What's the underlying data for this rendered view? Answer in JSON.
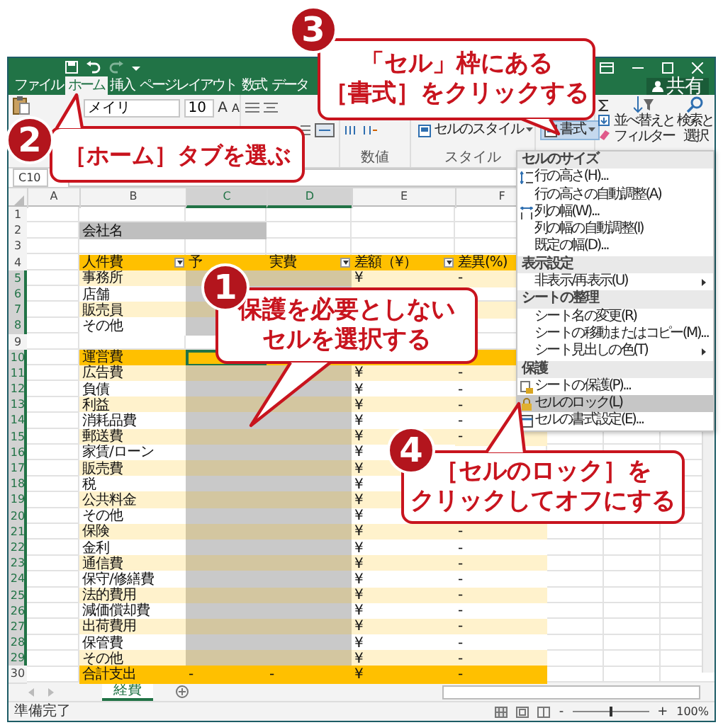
{
  "tabs": [
    {
      "label": "ファイル",
      "selected": false
    },
    {
      "label": "ホーム",
      "selected": true
    },
    {
      "label": "挿入",
      "selected": false
    },
    {
      "label": "ページレイアウト",
      "selected": false
    },
    {
      "label": "数式",
      "selected": false
    },
    {
      "label": "データ",
      "selected": false
    }
  ],
  "share_button": "共有",
  "ribbon": {
    "font_name": "メイリ",
    "font_size": "10",
    "font_grow": "A",
    "font_shrink": "A",
    "cell_styles": "セルのスタイル",
    "format": "書式",
    "sort_filter": [
      "並べ替えと",
      "フィルター"
    ],
    "find_select": [
      "検索と",
      "選択"
    ],
    "groups": [
      "数値",
      "スタイル"
    ]
  },
  "name_box": "C10",
  "columns": [
    {
      "label": "A",
      "selected": false
    },
    {
      "label": "B",
      "selected": false
    },
    {
      "label": "C",
      "selected": true
    },
    {
      "label": "D",
      "selected": true
    },
    {
      "label": "E",
      "selected": false
    },
    {
      "label": "F",
      "selected": false
    }
  ],
  "rows": [
    {
      "number": "1",
      "kind": "blank"
    },
    {
      "number": "2",
      "kind": "title",
      "b": "会社名"
    },
    {
      "number": "3",
      "kind": "blank"
    },
    {
      "number": "4",
      "kind": "header",
      "b": "人件費",
      "b_filter": true,
      "c": "予",
      "d": "実費",
      "d_filter": true,
      "e": "差額（¥）",
      "e_filter": true,
      "f": "差異(%)"
    },
    {
      "number": "5",
      "kind": "item",
      "band": true,
      "selected": true,
      "b": "事務所",
      "e": "¥",
      "f": "-"
    },
    {
      "number": "6",
      "kind": "item",
      "band": false,
      "selected": true,
      "b": "店舗"
    },
    {
      "number": "7",
      "kind": "item",
      "band": true,
      "selected": true,
      "b": "販売員"
    },
    {
      "number": "8",
      "kind": "item",
      "band": false,
      "selected": true,
      "b": "その他"
    },
    {
      "number": "9",
      "kind": "blank"
    },
    {
      "number": "10",
      "kind": "header",
      "b": "運営費",
      "c_active": true
    },
    {
      "number": "11",
      "kind": "item",
      "band": true,
      "selected": true,
      "b": "広告費",
      "e": "¥",
      "f": "-"
    },
    {
      "number": "12",
      "kind": "item",
      "band": false,
      "selected": true,
      "b": "負債",
      "e": "¥",
      "f": "-"
    },
    {
      "number": "13",
      "kind": "item",
      "band": true,
      "selected": true,
      "b": "利益",
      "e": "¥",
      "f": "-"
    },
    {
      "number": "14",
      "kind": "item",
      "band": false,
      "selected": true,
      "b": "消耗品費",
      "e": "¥",
      "f": "-"
    },
    {
      "number": "15",
      "kind": "item",
      "band": true,
      "selected": true,
      "b": "郵送費",
      "e": "¥",
      "f": "-"
    },
    {
      "number": "16",
      "kind": "item",
      "band": false,
      "selected": true,
      "b": "家賃/ローン",
      "e": "¥"
    },
    {
      "number": "17",
      "kind": "item",
      "band": true,
      "selected": true,
      "b": "販売費",
      "e": "¥"
    },
    {
      "number": "18",
      "kind": "item",
      "band": false,
      "selected": true,
      "b": "税",
      "e": "¥"
    },
    {
      "number": "19",
      "kind": "item",
      "band": true,
      "selected": true,
      "b": "公共料金",
      "e": "¥"
    },
    {
      "number": "20",
      "kind": "item",
      "band": false,
      "selected": true,
      "b": "その他",
      "e": "¥"
    },
    {
      "number": "21",
      "kind": "item",
      "band": true,
      "selected": true,
      "b": "保険",
      "e": "¥",
      "f": "-"
    },
    {
      "number": "22",
      "kind": "item",
      "band": false,
      "selected": true,
      "b": "金利",
      "e": "¥",
      "f": "-"
    },
    {
      "number": "23",
      "kind": "item",
      "band": true,
      "selected": true,
      "b": "通信費",
      "e": "¥",
      "f": "-"
    },
    {
      "number": "24",
      "kind": "item",
      "band": false,
      "selected": true,
      "b": "保守/修繕費",
      "e": "¥",
      "f": "-"
    },
    {
      "number": "25",
      "kind": "item",
      "band": true,
      "selected": true,
      "b": "法的費用",
      "e": "¥",
      "f": "-"
    },
    {
      "number": "26",
      "kind": "item",
      "band": false,
      "selected": true,
      "b": "減価償却費",
      "e": "¥",
      "f": "-"
    },
    {
      "number": "27",
      "kind": "item",
      "band": true,
      "selected": true,
      "b": "出荷費用",
      "e": "¥",
      "f": "-"
    },
    {
      "number": "28",
      "kind": "item",
      "band": false,
      "selected": true,
      "b": "保管費",
      "e": "¥",
      "f": "-"
    },
    {
      "number": "29",
      "kind": "item",
      "band": true,
      "selected": true,
      "b": "その他",
      "e": "¥",
      "f": "-"
    },
    {
      "number": "30",
      "kind": "total",
      "b": "合計支出",
      "c": "-",
      "d": "-",
      "e": "¥",
      "f": "-"
    }
  ],
  "format_menu": [
    {
      "kind": "header",
      "label": "セルのサイズ"
    },
    {
      "kind": "item",
      "label": "行の高さ(H)...",
      "selected": false
    },
    {
      "kind": "item",
      "label": "行の高さの自動調整(A)",
      "selected": false
    },
    {
      "kind": "item",
      "label": "列の幅(W)...",
      "selected": false
    },
    {
      "kind": "item",
      "label": "列の幅の自動調整(I)",
      "selected": false
    },
    {
      "kind": "item",
      "label": "既定の幅(D)...",
      "selected": false
    },
    {
      "kind": "header",
      "label": "表示設定"
    },
    {
      "kind": "submenu",
      "label": "非表示/再表示(U)",
      "selected": false
    },
    {
      "kind": "header",
      "label": "シートの整理"
    },
    {
      "kind": "item",
      "label": "シート名の変更(R)",
      "selected": false
    },
    {
      "kind": "item",
      "label": "シートの移動またはコピー(M)...",
      "selected": false
    },
    {
      "kind": "submenu",
      "label": "シート見出しの色(T)",
      "selected": false
    },
    {
      "kind": "header",
      "label": "保護"
    },
    {
      "kind": "item",
      "label": "シートの保護(P)...",
      "selected": false
    },
    {
      "kind": "item",
      "label": "セルのロック(L)",
      "selected": true
    },
    {
      "kind": "item",
      "label": "セルの書式設定(E)...",
      "selected": false
    }
  ],
  "callouts": [
    {
      "number": "1",
      "lines": [
        "保護を必要としない",
        "セルを選択する"
      ]
    },
    {
      "number": "2",
      "lines": [
        "［ホーム］タブを選ぶ"
      ]
    },
    {
      "number": "3",
      "lines": [
        "「セル」枠にある",
        "［書式］をクリックする"
      ]
    },
    {
      "number": "4",
      "lines": [
        "［セルのロック］を",
        "クリックしてオフにする"
      ]
    }
  ],
  "sheets": [
    {
      "label": "経費",
      "selected": true
    }
  ],
  "status_bar": {
    "text": "準備完了",
    "zoom_out": "-",
    "zoom_in": "+",
    "zoom": "100%",
    "zoom_slider": {
      "level": 0.5
    }
  }
}
